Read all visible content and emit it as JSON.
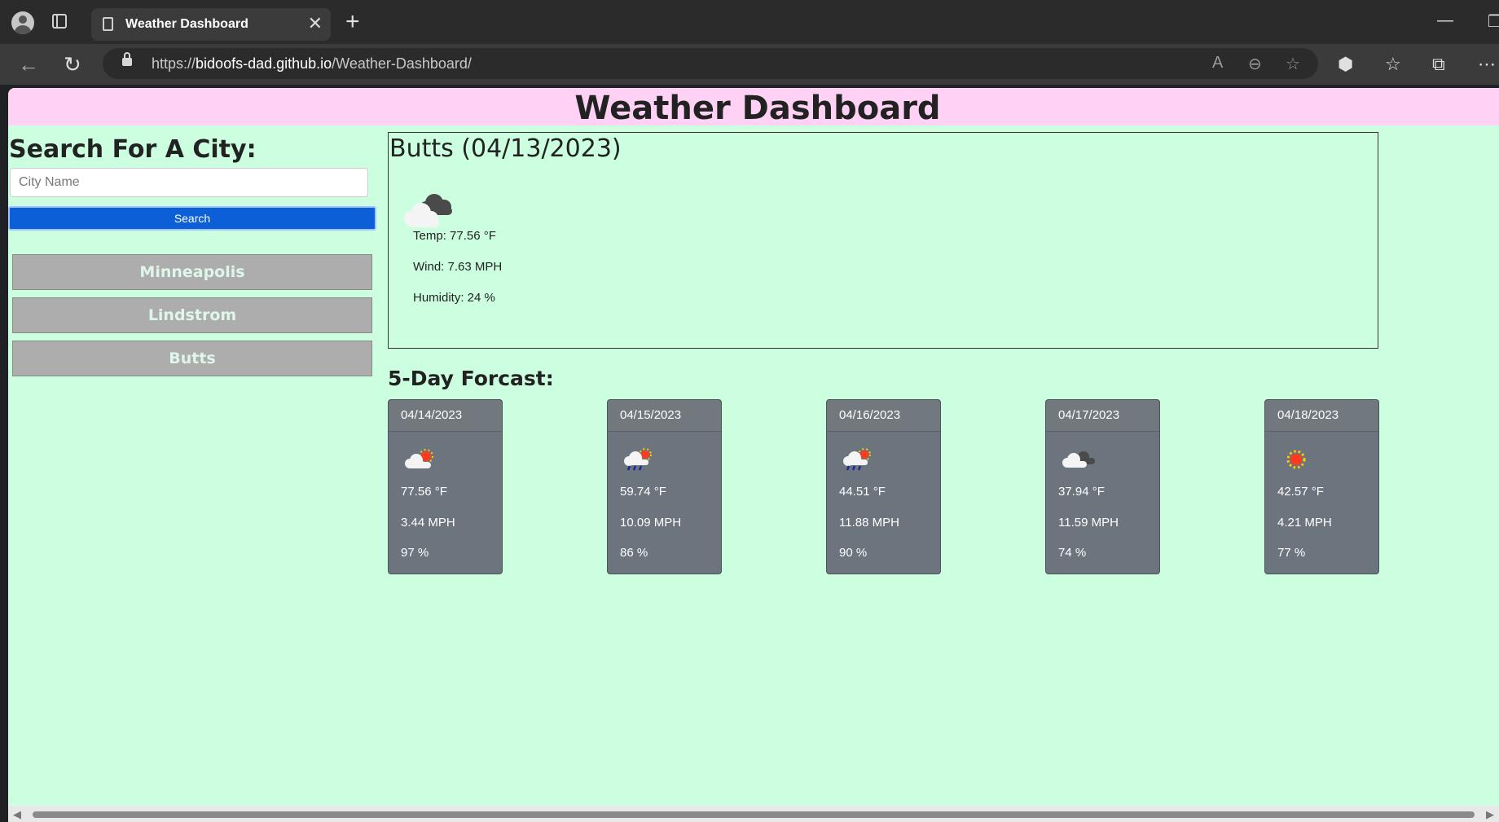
{
  "browser": {
    "tab_title": "Weather Dashboard",
    "url_prefix": "https://",
    "url_host": "bidoofs-dad.github.io",
    "url_path": "/Weather-Dashboard/"
  },
  "page": {
    "title": "Weather Dashboard",
    "search_label": "Search For A City:",
    "search_placeholder": "City Name",
    "search_button": "Search",
    "history": [
      "Minneapolis",
      "Lindstrom",
      "Butts"
    ],
    "colors": {
      "header_bg": "#ffd1f4",
      "page_bg": "#ccffe0",
      "search_button": "#0d5fd8",
      "card_bg": "#6c757d",
      "history_button": "#adadad"
    }
  },
  "current": {
    "title": "Butts (04/13/2023)",
    "icon": "broken-clouds-icon",
    "temp": "Temp: 77.56 °F",
    "wind": "Wind: 7.63 MPH",
    "humidity": "Humidity: 24 %"
  },
  "forecast": {
    "label": "5-Day Forcast:",
    "days": [
      {
        "date": "04/14/2023",
        "icon": "few-clouds-icon",
        "temp": "77.56 °F",
        "wind": "3.44 MPH",
        "humidity": "97 %"
      },
      {
        "date": "04/15/2023",
        "icon": "rain-icon",
        "temp": "59.74 °F",
        "wind": "10.09 MPH",
        "humidity": "86 %"
      },
      {
        "date": "04/16/2023",
        "icon": "rain-icon",
        "temp": "44.51 °F",
        "wind": "11.88 MPH",
        "humidity": "90 %"
      },
      {
        "date": "04/17/2023",
        "icon": "overcast-clouds-icon",
        "temp": "37.94 °F",
        "wind": "11.59 MPH",
        "humidity": "74 %"
      },
      {
        "date": "04/18/2023",
        "icon": "clear-sky-icon",
        "temp": "42.57 °F",
        "wind": "4.21 MPH",
        "humidity": "77 %"
      }
    ]
  }
}
